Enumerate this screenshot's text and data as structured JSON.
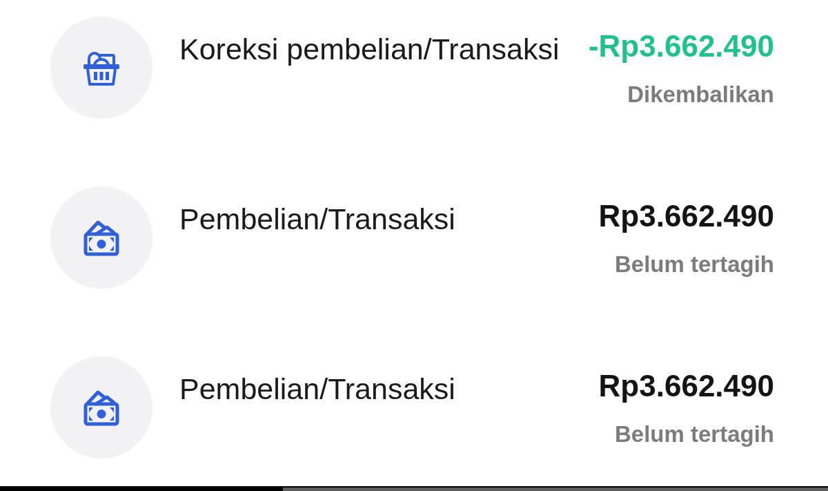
{
  "transactions": [
    {
      "kind": "refund",
      "title": "Koreksi pembelian/Transaksi",
      "amount": "-Rp3.662.490",
      "status": "Dikembalikan"
    },
    {
      "kind": "purchase",
      "title": "Pembelian/Transaksi",
      "amount": "Rp3.662.490",
      "status": "Belum tertagih"
    },
    {
      "kind": "purchase",
      "title": "Pembelian/Transaksi",
      "amount": "Rp3.662.490",
      "status": "Belum tertagih"
    }
  ]
}
